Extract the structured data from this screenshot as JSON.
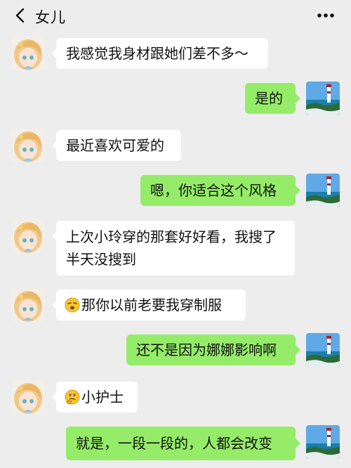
{
  "header": {
    "title": "女儿",
    "back_icon": "chevron-left-icon",
    "more_icon": "ellipsis-icon"
  },
  "colors": {
    "background": "#ededed",
    "bubble_incoming": "#ffffff",
    "bubble_outgoing": "#95ec69"
  },
  "messages": [
    {
      "side": "left",
      "text": "我感觉我身材跟她们差不多～"
    },
    {
      "side": "right",
      "text": "是的"
    },
    {
      "side": "left",
      "text": "最近喜欢可爱的"
    },
    {
      "side": "right",
      "text": "嗯，你适合这个风格"
    },
    {
      "side": "left",
      "text": "上次小玲穿的那套好好看，我搜了\n半天没搜到"
    },
    {
      "side": "left",
      "emoji": "squinting-face-emoji",
      "text": "那你以前老要我穿制服"
    },
    {
      "side": "right",
      "text": "还不是因为娜娜影响啊"
    },
    {
      "side": "left",
      "emoji": "thinking-face-emoji",
      "text": "小护士"
    },
    {
      "side": "right",
      "text": "就是，一段一段的，人都会改变"
    }
  ]
}
